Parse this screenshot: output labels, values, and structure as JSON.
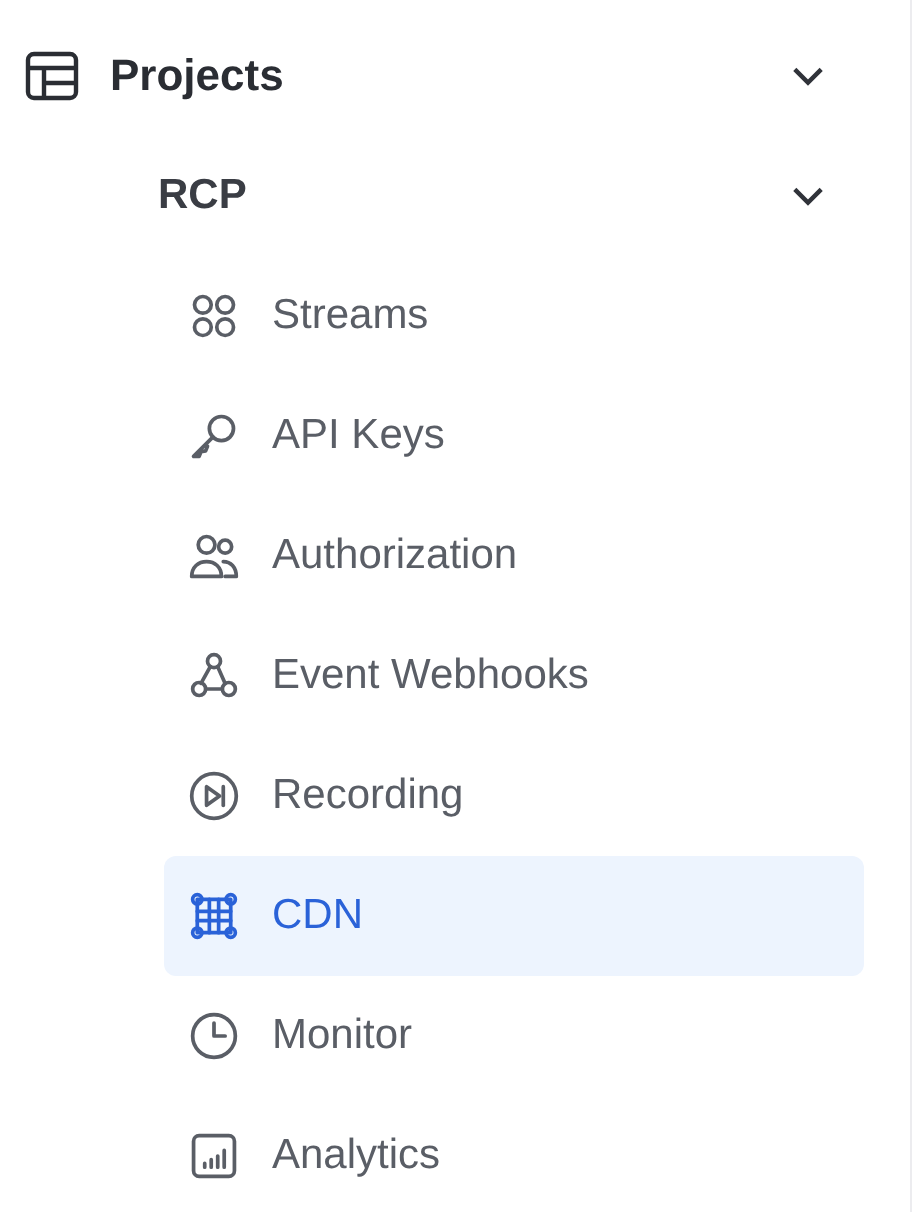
{
  "sidebar": {
    "section": {
      "label": "Projects",
      "kind": "table",
      "expanded": true,
      "project": {
        "label": "RCP",
        "expanded": true,
        "items": [
          {
            "label": "Streams",
            "kind": "grid",
            "selected": false
          },
          {
            "label": "API Keys",
            "kind": "key",
            "selected": false
          },
          {
            "label": "Authorization",
            "kind": "users",
            "selected": false
          },
          {
            "label": "Event Webhooks",
            "kind": "webhook",
            "selected": false
          },
          {
            "label": "Recording",
            "kind": "play",
            "selected": false
          },
          {
            "label": "CDN",
            "kind": "network",
            "selected": true
          },
          {
            "label": "Monitor",
            "kind": "clock",
            "selected": false
          },
          {
            "label": "Analytics",
            "kind": "chart",
            "selected": false
          }
        ]
      }
    }
  }
}
